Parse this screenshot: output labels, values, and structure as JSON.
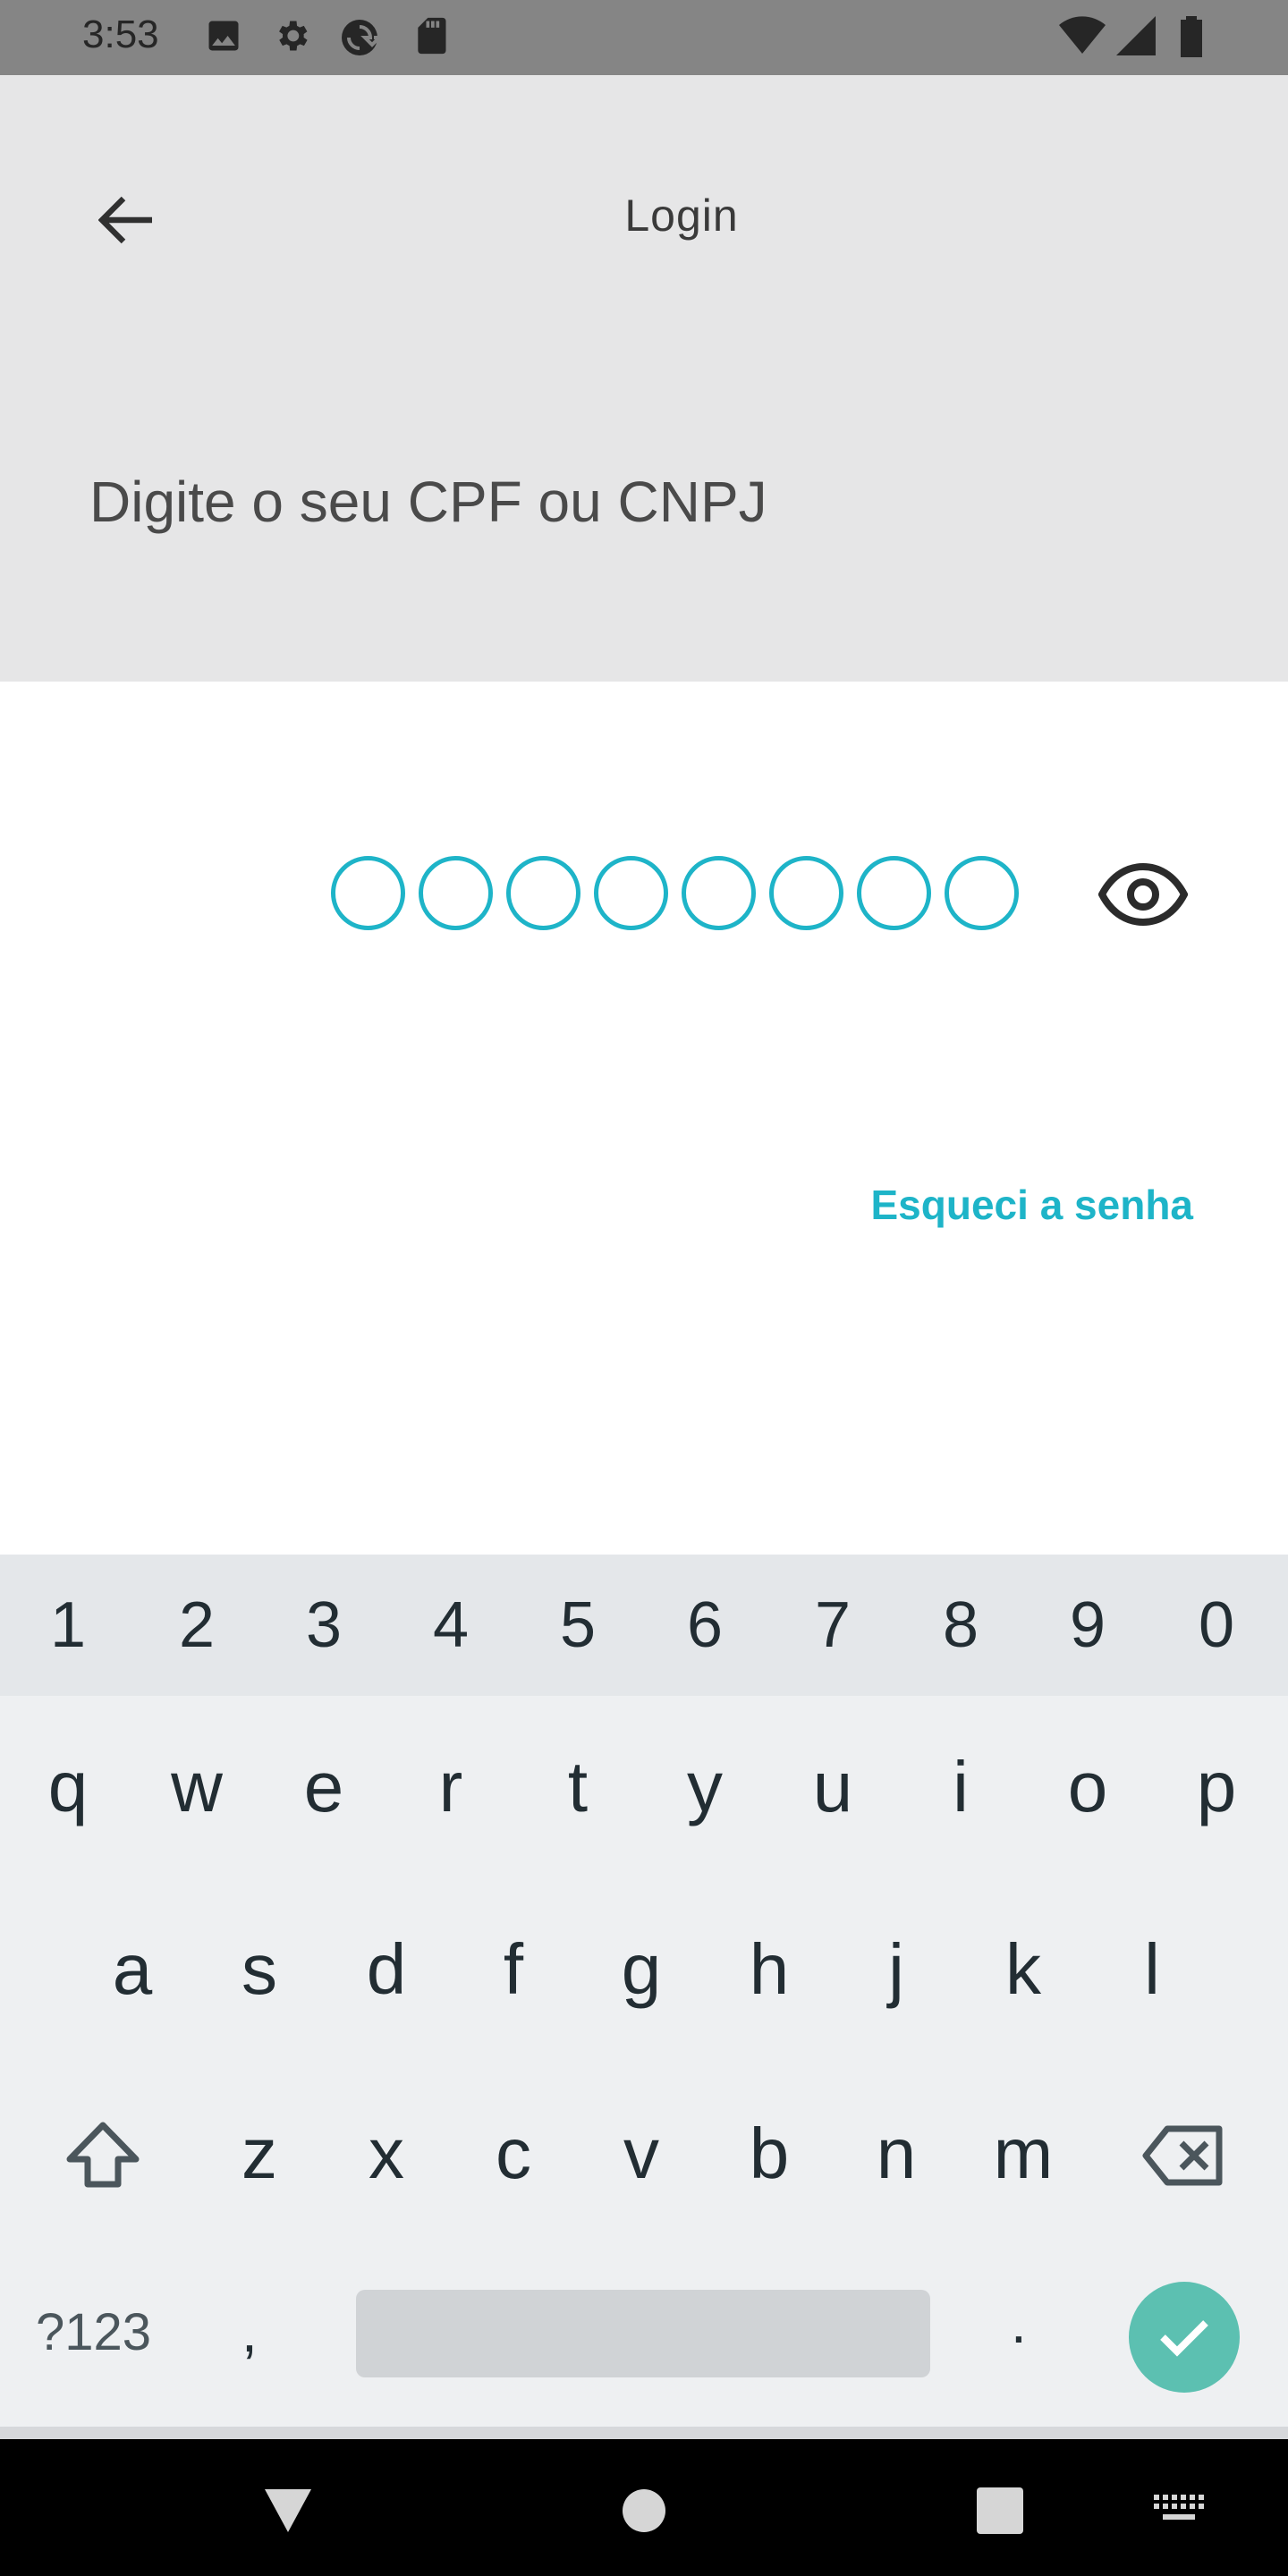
{
  "status_bar": {
    "time": "3:53",
    "icons_left": [
      "image-icon",
      "gear-icon",
      "sync-icon",
      "sd-card-icon"
    ],
    "icons_right": [
      "wifi-icon",
      "signal-icon",
      "battery-icon"
    ]
  },
  "app_bar": {
    "title": "Login",
    "back_icon": "arrow-left-icon"
  },
  "header": {
    "subtitle": "Digite o seu CPF ou CNPJ"
  },
  "password": {
    "length": 8,
    "filled": 0,
    "accent_color": "#1eb4c8",
    "toggle_icon": "eye-icon"
  },
  "forgot_password_label": "Esqueci a senha",
  "keyboard": {
    "number_row": [
      "1",
      "2",
      "3",
      "4",
      "5",
      "6",
      "7",
      "8",
      "9",
      "0"
    ],
    "row1": [
      "q",
      "w",
      "e",
      "r",
      "t",
      "y",
      "u",
      "i",
      "o",
      "p"
    ],
    "row2": [
      "a",
      "s",
      "d",
      "f",
      "g",
      "h",
      "j",
      "k",
      "l"
    ],
    "row3": [
      "z",
      "x",
      "c",
      "v",
      "b",
      "n",
      "m"
    ],
    "symbols_label": "?123",
    "comma_label": ",",
    "period_label": ".",
    "enter_color": "#5cc0b1"
  },
  "nav_bar": {
    "icons": [
      "back-triangle-icon",
      "home-circle-icon",
      "recents-square-icon",
      "keyboard-icon"
    ]
  }
}
